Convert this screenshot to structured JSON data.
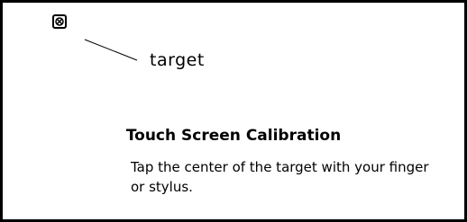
{
  "diagram": {
    "target_icon": "target-crosshair-icon",
    "target_label": "target"
  },
  "calibration": {
    "title": "Touch Screen Calibration",
    "instructions": "Tap the center of the target with your finger or stylus."
  },
  "colors": {
    "background": "#ffffff",
    "foreground": "#000000"
  }
}
